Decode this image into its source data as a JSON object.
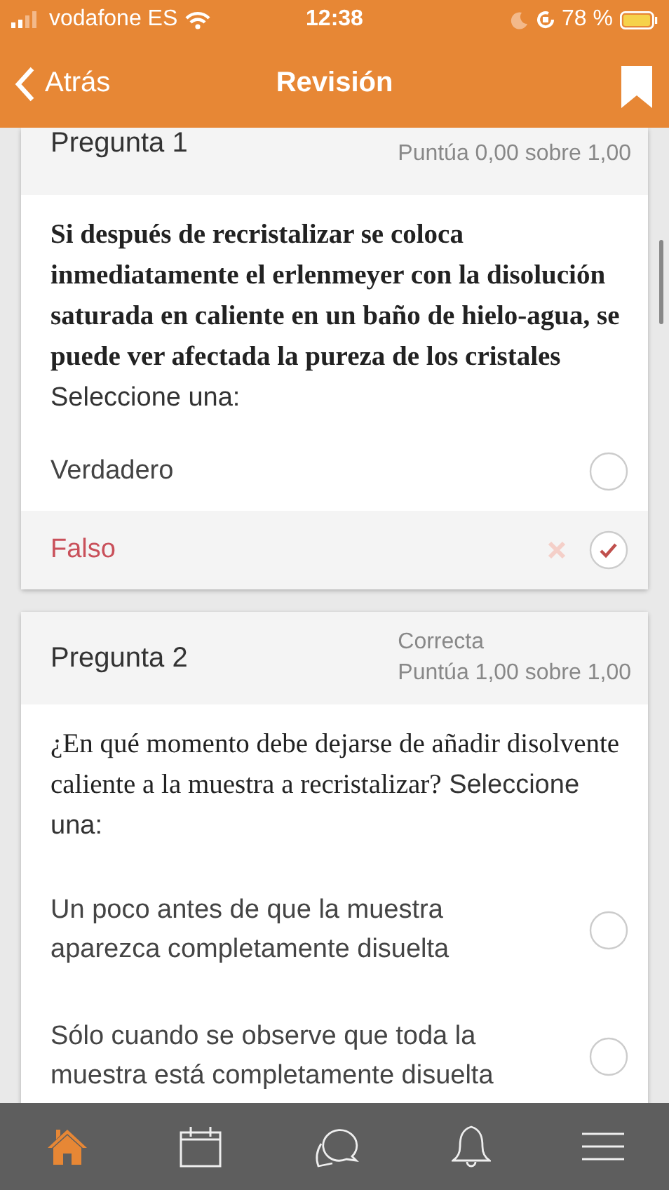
{
  "status_bar": {
    "carrier": "vodafone ES",
    "time": "12:38",
    "battery": "78 %"
  },
  "nav": {
    "back": "Atrás",
    "title": "Revisión"
  },
  "questions": [
    {
      "title": "Pregunta 1",
      "grade": "Puntúa 0,00 sobre 1,00",
      "text": "Si después de recristalizar se coloca inmediatamente el erlenmeyer con la disolución saturada en caliente en un baño de hielo-agua, se puede ver afectada la pureza de los cristales",
      "emphasis": true,
      "prompt": "Seleccione una:",
      "options": [
        {
          "label": "Verdadero",
          "selected": false,
          "kind": "plain"
        },
        {
          "label": "Falso",
          "selected": true,
          "kind": "incorrect"
        }
      ]
    },
    {
      "title": "Pregunta 2",
      "state": "Correcta",
      "grade": "Puntúa 1,00 sobre 1,00",
      "text": "¿En qué momento debe dejarse de añadir disolvente caliente a la muestra a recristalizar?",
      "emphasis": false,
      "prompt": "Seleccione una:",
      "options": [
        {
          "label": "Un poco antes de que la muestra aparezca completamente disuelta",
          "selected": false,
          "kind": "plain"
        },
        {
          "label": "Sólo cuando se observe que toda la muestra está completamente disuelta",
          "selected": false,
          "kind": "plain"
        }
      ]
    }
  ],
  "tab_bar": [
    {
      "kind": "home",
      "selected": true
    },
    {
      "kind": "calendar",
      "selected": false
    },
    {
      "kind": "chat",
      "selected": false
    },
    {
      "kind": "bell",
      "selected": false
    },
    {
      "kind": "menu",
      "selected": false
    }
  ]
}
